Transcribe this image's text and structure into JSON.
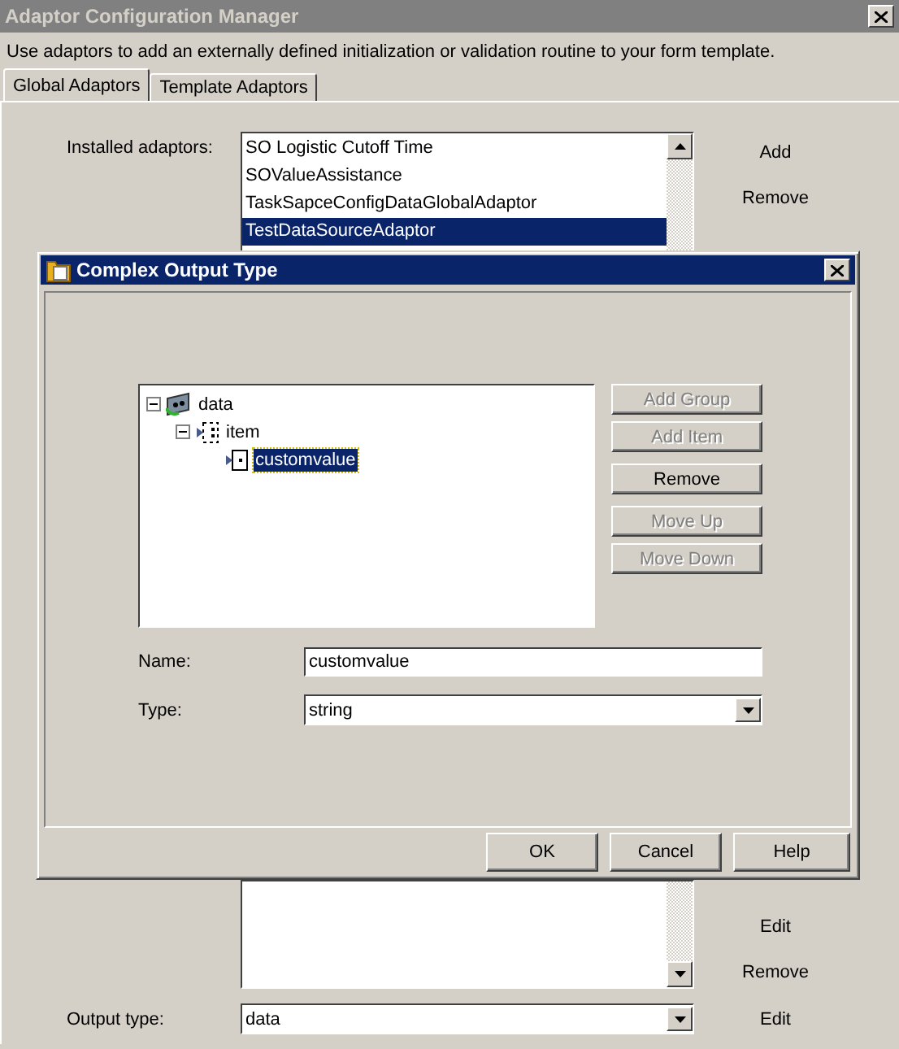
{
  "window": {
    "title": "Adaptor Configuration Manager"
  },
  "description": "Use adaptors to add an externally defined initialization or validation routine to your form template.",
  "tabs": [
    {
      "label": "Global Adaptors",
      "selected": true
    },
    {
      "label": "Template Adaptors",
      "selected": false
    }
  ],
  "installed": {
    "label": "Installed adaptors:",
    "items": [
      {
        "label": "SO Logistic Cutoff Time",
        "selected": false
      },
      {
        "label": "SOValueAssistance",
        "selected": false
      },
      {
        "label": "TaskSapceConfigDataGlobalAdaptor",
        "selected": false
      },
      {
        "label": "TestDataSourceAdaptor",
        "selected": true
      }
    ],
    "buttons": [
      "Add",
      "Remove"
    ]
  },
  "lower_list": {
    "buttons": [
      "Edit",
      "Remove"
    ]
  },
  "output_type": {
    "label": "Output type:",
    "value": "data",
    "button": "Edit"
  },
  "dialog": {
    "title": "Complex Output Type",
    "tree": [
      {
        "label": "data",
        "kind": "group",
        "expanded": true,
        "selected": false,
        "children": [
          {
            "label": "item",
            "kind": "item",
            "expanded": true,
            "selected": false,
            "children": [
              {
                "label": "customvalue",
                "kind": "value",
                "selected": true
              }
            ]
          }
        ]
      }
    ],
    "buttons": [
      {
        "label": "Add Group",
        "disabled": true
      },
      {
        "label": "Add Item",
        "disabled": true
      },
      {
        "label": "Remove",
        "disabled": false
      },
      {
        "label": "Move Up",
        "disabled": true
      },
      {
        "label": "Move Down",
        "disabled": true
      }
    ],
    "name": {
      "label": "Name:",
      "value": "customvalue"
    },
    "type": {
      "label": "Type:",
      "value": "string"
    },
    "footer": [
      "OK",
      "Cancel",
      "Help"
    ]
  }
}
